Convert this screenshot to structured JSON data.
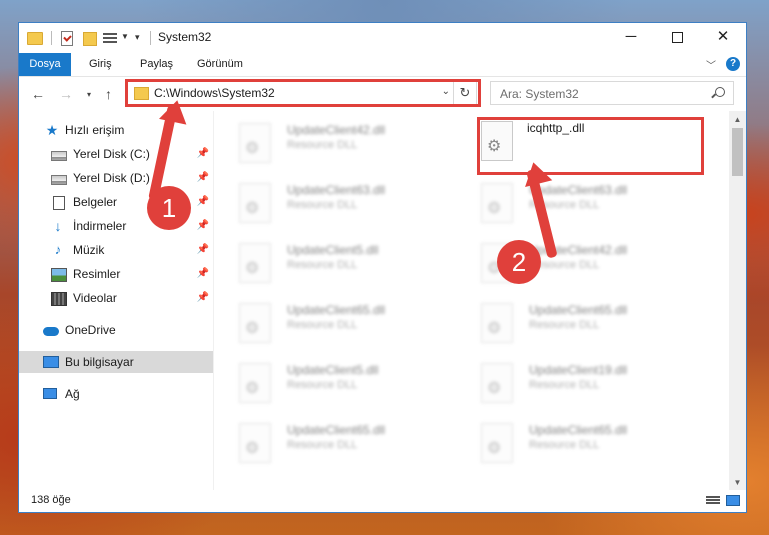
{
  "window": {
    "title": "System32",
    "controls": {
      "minimize": "—",
      "maximize": "",
      "close": "✕"
    }
  },
  "ribbon": {
    "tabs": [
      "Dosya",
      "Giriş",
      "Paylaş",
      "Görünüm"
    ]
  },
  "address": {
    "path": "C:\\Windows\\System32",
    "search_placeholder": "Ara: System32"
  },
  "sidebar": {
    "items": [
      {
        "label": "Hızlı erişim",
        "icon": "star-icon"
      },
      {
        "label": "Yerel Disk (C:)",
        "icon": "drive-icon",
        "pinned": true
      },
      {
        "label": "Yerel Disk (D:)",
        "icon": "drive-icon",
        "pinned": true
      },
      {
        "label": "Belgeler",
        "icon": "documents-icon",
        "pinned": true
      },
      {
        "label": "İndirmeler",
        "icon": "downloads-icon",
        "pinned": true
      },
      {
        "label": "Müzik",
        "icon": "music-icon",
        "pinned": true
      },
      {
        "label": "Resimler",
        "icon": "pictures-icon",
        "pinned": true
      },
      {
        "label": "Videolar",
        "icon": "videos-icon",
        "pinned": true
      },
      {
        "label": "OneDrive",
        "icon": "onedrive-icon"
      },
      {
        "label": "Bu bilgisayar",
        "icon": "computer-icon",
        "selected": true
      },
      {
        "label": "Ağ",
        "icon": "network-icon"
      }
    ]
  },
  "files": [
    {
      "name": "UpdateClient42.dll",
      "type": "Resource DLL",
      "blurred": true
    },
    {
      "name": "icqhttp_.dll",
      "type": "",
      "blurred": false,
      "highlighted": true
    },
    {
      "name": "UpdateClient63.dll",
      "type": "Resource DLL",
      "blurred": true
    },
    {
      "name": "UpdateClient63.dll",
      "type": "Resource DLL",
      "blurred": true
    },
    {
      "name": "UpdateClient5.dll",
      "type": "Resource DLL",
      "blurred": true
    },
    {
      "name": "UpdateClient42.dll",
      "type": "Resource DLL",
      "blurred": true
    },
    {
      "name": "UpdateClient65.dll",
      "type": "Resource DLL",
      "blurred": true
    },
    {
      "name": "UpdateClient65.dll",
      "type": "Resource DLL",
      "blurred": true
    },
    {
      "name": "UpdateClient5.dll",
      "type": "Resource DLL",
      "blurred": true
    },
    {
      "name": "UpdateClient19.dll",
      "type": "Resource DLL",
      "blurred": true
    },
    {
      "name": "UpdateClient65.dll",
      "type": "Resource DLL",
      "blurred": true
    },
    {
      "name": "UpdateClient65.dll",
      "type": "Resource DLL",
      "blurred": true
    }
  ],
  "status": {
    "item_count": "138 öğe"
  },
  "annotations": {
    "step1": "1",
    "step2": "2",
    "color": "#e0403b"
  }
}
